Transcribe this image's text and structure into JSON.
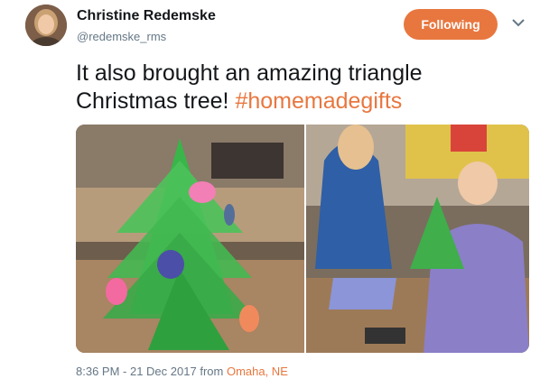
{
  "author": {
    "name": "Christine Redemske",
    "handle": "@redemske_rms"
  },
  "follow_button": {
    "label": "Following"
  },
  "tweet": {
    "text": "It also brought an amazing triangle Christmas tree! ",
    "hashtag": "#homemadegifts"
  },
  "photos": [
    {
      "icon": "paper-triangle-christmas-tree-photo"
    },
    {
      "icon": "students-folding-paper-tree-photo"
    }
  ],
  "meta": {
    "time_date": "8:36 PM - 21 Dec 2017",
    "from": "from",
    "location": "Omaha, NE"
  },
  "colors": {
    "accent": "#e8773f",
    "secondary_text": "#657786"
  }
}
